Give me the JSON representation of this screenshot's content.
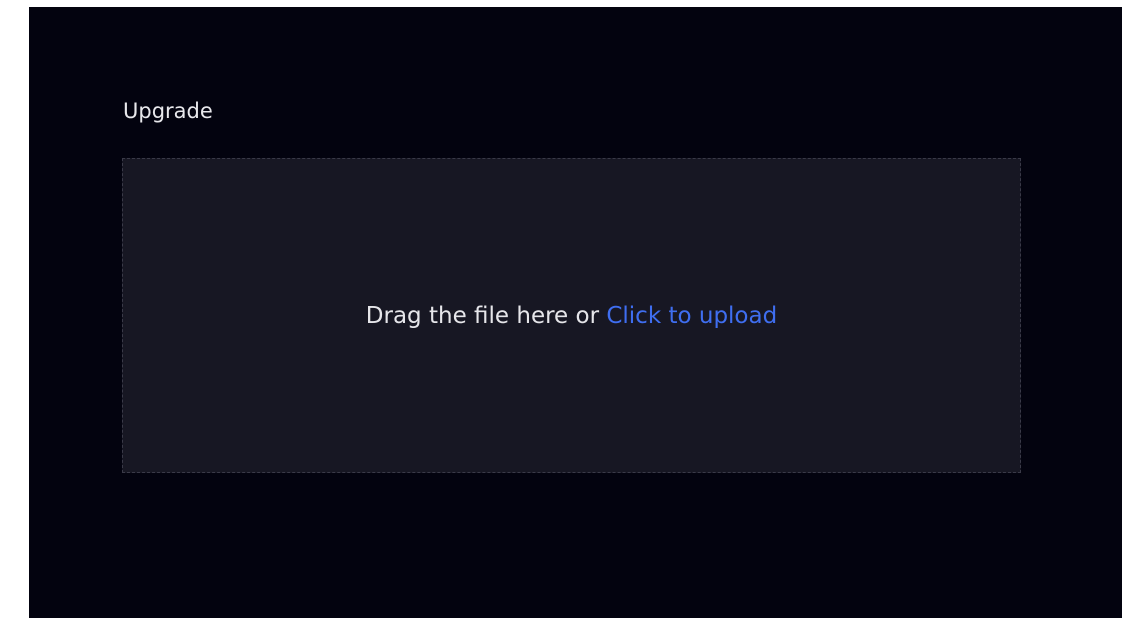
{
  "section": {
    "title": "Upgrade"
  },
  "dropzone": {
    "prompt": "Drag the file here or ",
    "link_label": "Click to upload"
  },
  "colors": {
    "background": "#03030f",
    "dropzone_fill": "#171723",
    "dropzone_border": "#3a3a48",
    "text": "#e6e6ea",
    "link": "#3f6ef0"
  }
}
